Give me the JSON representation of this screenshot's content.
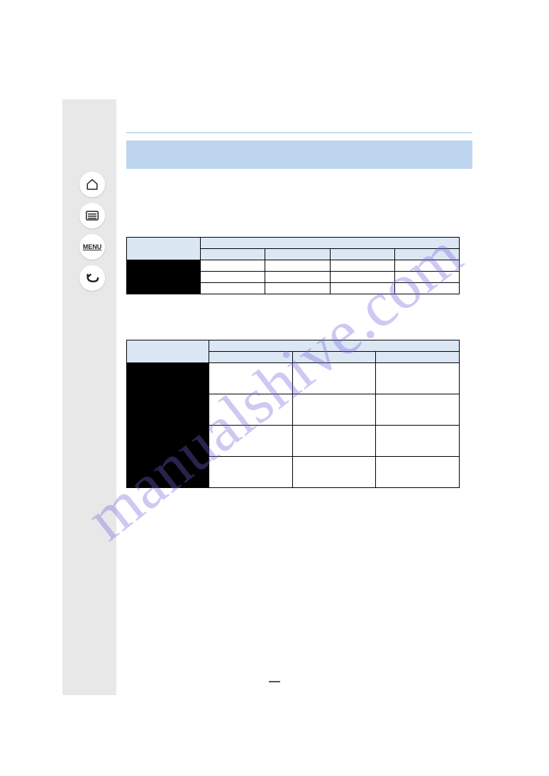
{
  "nav": {
    "home": "home-icon",
    "keyboard": "keyboard-icon",
    "menu_label": "MENU",
    "back": "back-icon"
  },
  "watermark": "manualshive.com",
  "table1": {
    "header_left": "",
    "header_cols": [
      "",
      "",
      "",
      ""
    ],
    "rows": [
      {
        "label": "",
        "cells": [
          "",
          "",
          "",
          ""
        ]
      },
      {
        "label": "",
        "cells": [
          "",
          "",
          "",
          ""
        ]
      },
      {
        "label": "",
        "cells": [
          "",
          "",
          "",
          ""
        ]
      }
    ]
  },
  "table2": {
    "header_left": "",
    "header_cols": [
      "",
      "",
      ""
    ],
    "rows": [
      {
        "label": "",
        "cells": [
          "",
          "",
          ""
        ]
      },
      {
        "label": "",
        "cells": [
          "",
          "",
          ""
        ]
      },
      {
        "label": "",
        "cells": [
          "",
          "",
          ""
        ]
      },
      {
        "label": "",
        "cells": [
          "",
          "",
          ""
        ]
      }
    ]
  }
}
